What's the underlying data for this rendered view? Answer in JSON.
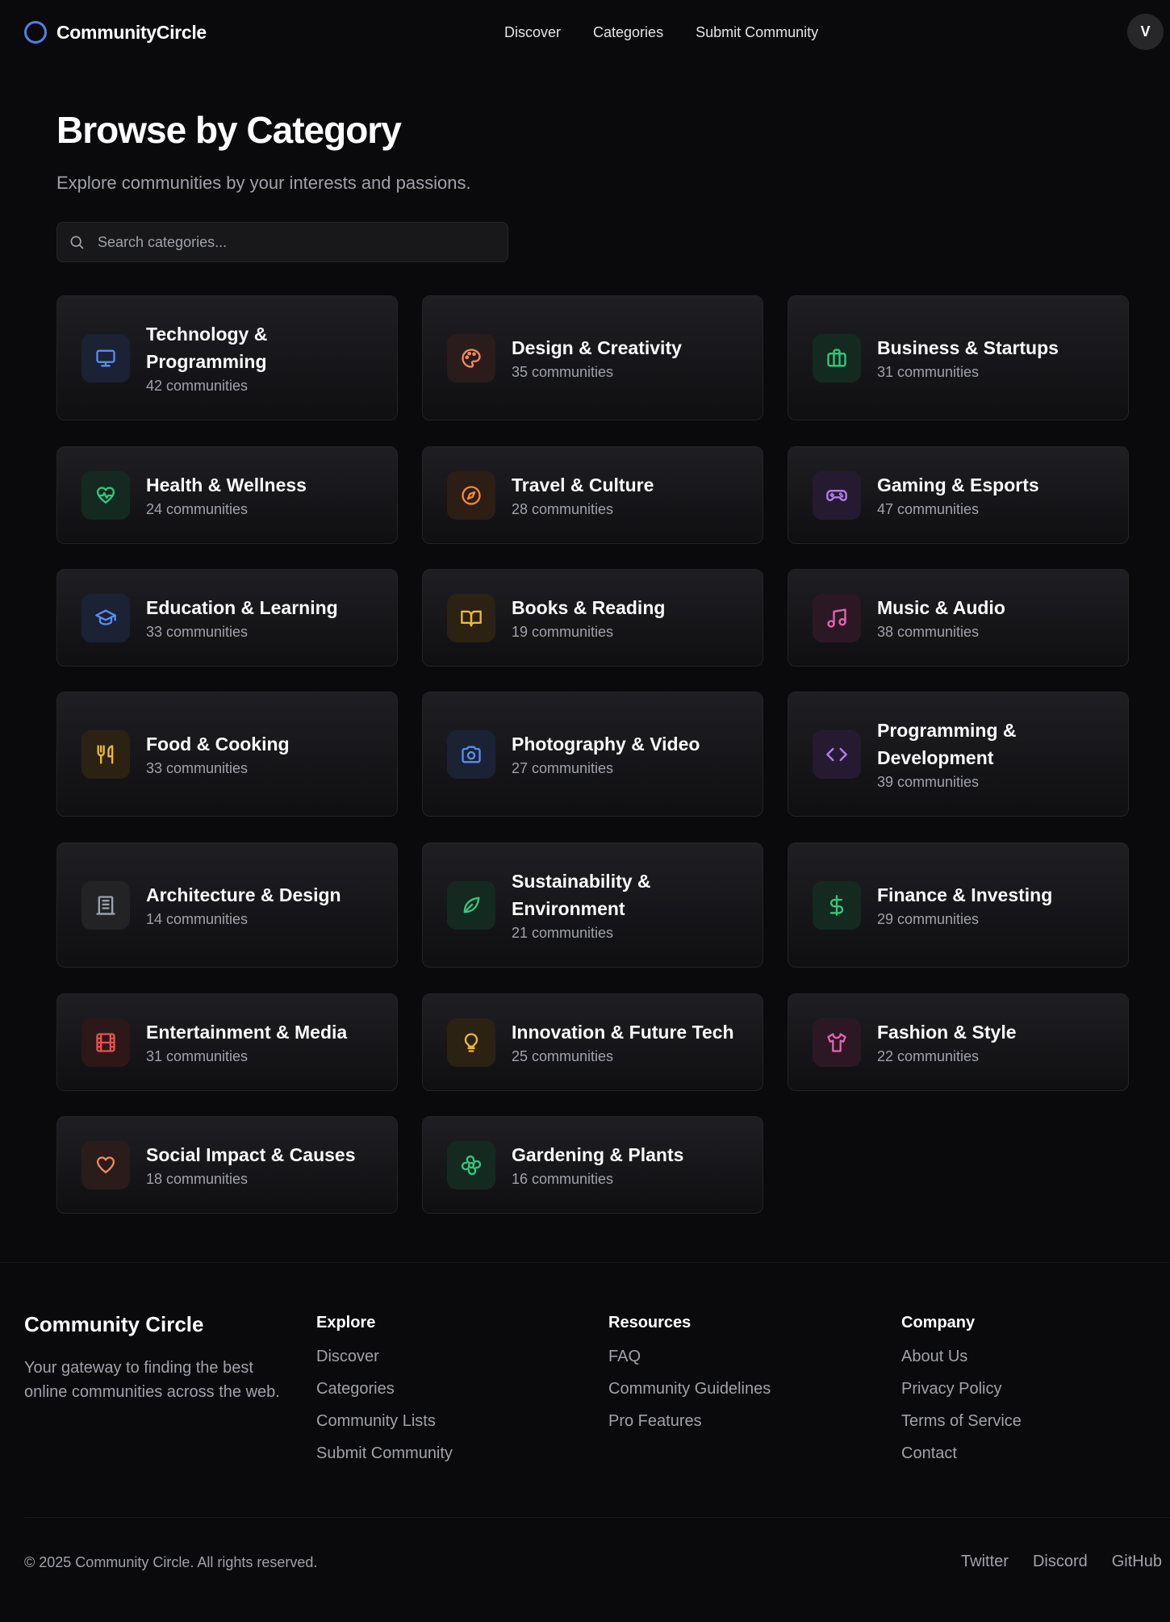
{
  "brand": {
    "name": "CommunityCircle"
  },
  "nav": {
    "items": [
      "Discover",
      "Categories",
      "Submit Community"
    ]
  },
  "user": {
    "initial": "V"
  },
  "hero": {
    "title": "Browse by Category",
    "subtitle": "Explore communities by your interests and passions.",
    "search_placeholder": "Search categories..."
  },
  "categories": [
    {
      "title": "Technology & Programming",
      "count": "42 communities",
      "icon": "monitor-icon",
      "color": "#5b8def",
      "bg": "#1a2234"
    },
    {
      "title": "Design & Creativity",
      "count": "35 communities",
      "icon": "palette-icon",
      "color": "#f08a5d",
      "bg": "#2a1c1a"
    },
    {
      "title": "Business & Startups",
      "count": "31 communities",
      "icon": "briefcase-icon",
      "color": "#34c77b",
      "bg": "#142a20"
    },
    {
      "title": "Health & Wellness",
      "count": "24 communities",
      "icon": "heart-pulse-icon",
      "color": "#34c77b",
      "bg": "#142a20"
    },
    {
      "title": "Travel & Culture",
      "count": "28 communities",
      "icon": "compass-icon",
      "color": "#f08a3d",
      "bg": "#2c1e15"
    },
    {
      "title": "Gaming & Esports",
      "count": "47 communities",
      "icon": "gamepad-icon",
      "color": "#b77cf0",
      "bg": "#251b31"
    },
    {
      "title": "Education & Learning",
      "count": "33 communities",
      "icon": "graduation-cap-icon",
      "color": "#5b8def",
      "bg": "#1a2234"
    },
    {
      "title": "Books & Reading",
      "count": "19 communities",
      "icon": "book-open-icon",
      "color": "#f0b83a",
      "bg": "#2b2214"
    },
    {
      "title": "Music & Audio",
      "count": "38 communities",
      "icon": "music-icon",
      "color": "#e265b0",
      "bg": "#2c1825"
    },
    {
      "title": "Food & Cooking",
      "count": "33 communities",
      "icon": "utensils-icon",
      "color": "#f0b83a",
      "bg": "#2b2214"
    },
    {
      "title": "Photography & Video",
      "count": "27 communities",
      "icon": "camera-icon",
      "color": "#5b8def",
      "bg": "#1a2234"
    },
    {
      "title": "Programming & Development",
      "count": "39 communities",
      "icon": "code-icon",
      "color": "#b77cf0",
      "bg": "#251b31"
    },
    {
      "title": "Architecture & Design",
      "count": "14 communities",
      "icon": "building-icon",
      "color": "#9ca3af",
      "bg": "#232326"
    },
    {
      "title": "Sustainability & Environment",
      "count": "21 communities",
      "icon": "leaf-icon",
      "color": "#34c77b",
      "bg": "#142a20"
    },
    {
      "title": "Finance & Investing",
      "count": "29 communities",
      "icon": "dollar-icon",
      "color": "#34c77b",
      "bg": "#142a20"
    },
    {
      "title": "Entertainment & Media",
      "count": "31 communities",
      "icon": "film-icon",
      "color": "#e5534b",
      "bg": "#2c1819"
    },
    {
      "title": "Innovation & Future Tech",
      "count": "25 communities",
      "icon": "lightbulb-icon",
      "color": "#f0b83a",
      "bg": "#2b2214"
    },
    {
      "title": "Fashion & Style",
      "count": "22 communities",
      "icon": "shirt-icon",
      "color": "#e265b0",
      "bg": "#2c1825"
    },
    {
      "title": "Social Impact & Causes",
      "count": "18 communities",
      "icon": "heart-icon",
      "color": "#f08a5d",
      "bg": "#2a1c1a"
    },
    {
      "title": "Gardening & Plants",
      "count": "16 communities",
      "icon": "flower-icon",
      "color": "#34c77b",
      "bg": "#142a20"
    }
  ],
  "footer": {
    "brand": "Community Circle",
    "description": "Your gateway to finding the best online communities across the web.",
    "columns": [
      {
        "title": "Explore",
        "links": [
          "Discover",
          "Categories",
          "Community Lists",
          "Submit Community"
        ]
      },
      {
        "title": "Resources",
        "links": [
          "FAQ",
          "Community Guidelines",
          "Pro Features"
        ]
      },
      {
        "title": "Company",
        "links": [
          "About Us",
          "Privacy Policy",
          "Terms of Service",
          "Contact"
        ]
      }
    ],
    "copyright": "© 2025 Community Circle. All rights reserved.",
    "social": [
      "Twitter",
      "Discord",
      "GitHub"
    ]
  }
}
